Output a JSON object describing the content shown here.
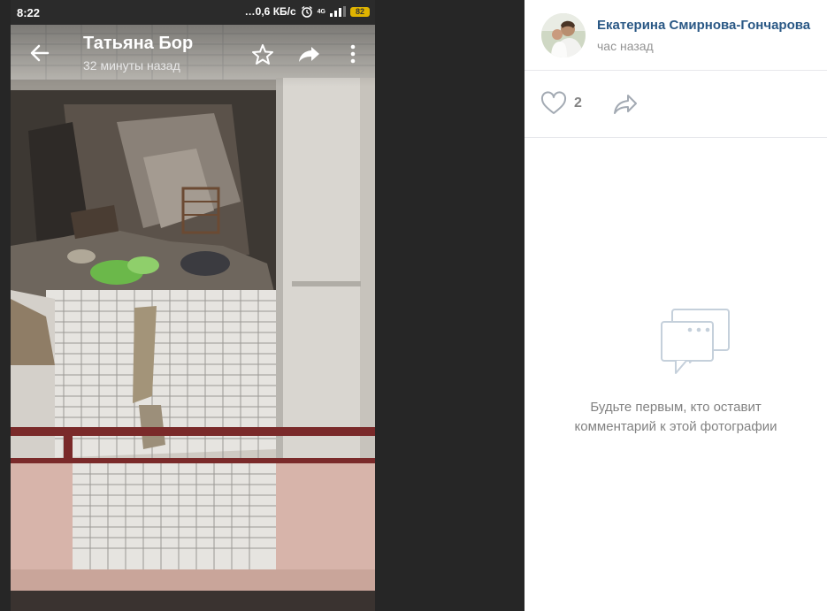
{
  "status_bar": {
    "time": "8:22",
    "network_speed": "…0,6 КБ/с",
    "network_type": "4G",
    "battery": "82"
  },
  "photo_viewer": {
    "author": "Татьяна Бор",
    "posted_ago": "32 минуты назад"
  },
  "post": {
    "author_name": "Екатерина Смирнова-Гончарова",
    "time": "час назад",
    "likes": "2"
  },
  "comments": {
    "empty_line1": "Будьте первым, кто оставит",
    "empty_line2": "комментарий к этой фотографии"
  },
  "colors": {
    "link": "#2a5885",
    "muted": "#828282",
    "divider": "#e7e8ec"
  },
  "icons": [
    "back-arrow-icon",
    "star-icon",
    "share-icon",
    "more-icon",
    "alarm-icon",
    "signal-icon",
    "heart-icon",
    "comments-empty-icon"
  ]
}
